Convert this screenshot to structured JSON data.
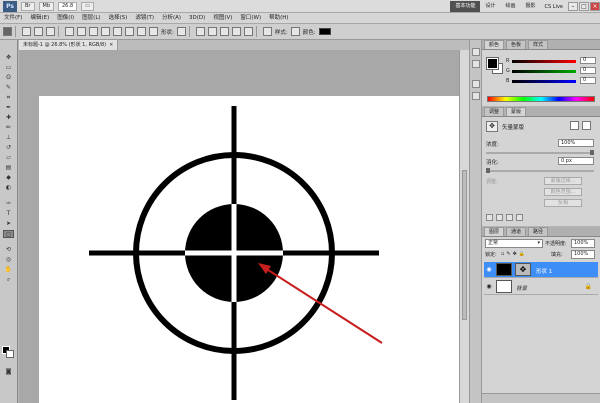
{
  "appbar": {
    "logo": "Ps",
    "zoom": "26.8",
    "workspaces": [
      {
        "label": "基本功能",
        "active": true
      },
      {
        "label": "设计",
        "active": false
      },
      {
        "label": "绘画",
        "active": false
      },
      {
        "label": "摄影",
        "active": false
      }
    ],
    "cs_live": "CS Live"
  },
  "menu": [
    "文件(F)",
    "编辑(E)",
    "图像(I)",
    "图层(L)",
    "选择(S)",
    "滤镜(T)",
    "分析(A)",
    "3D(D)",
    "视图(V)",
    "窗口(W)",
    "帮助(H)"
  ],
  "options": {
    "shape_label": "形状:",
    "style_label": "样式:",
    "color_label": "颜色:",
    "color_value": "#000000"
  },
  "document": {
    "tab_title": "未标题-1 @ 26.8% (形状 1, RGB/8)",
    "close": "×"
  },
  "color_panel": {
    "tabs": [
      "颜色",
      "色板",
      "样式"
    ],
    "channels": [
      {
        "name": "R",
        "value": "0",
        "color": "#ff0000"
      },
      {
        "name": "G",
        "value": "0",
        "color": "#00aa00"
      },
      {
        "name": "B",
        "value": "0",
        "color": "#0000ff"
      }
    ]
  },
  "masks_panel": {
    "tabs": [
      "调整",
      "蒙版"
    ],
    "title": "矢量蒙版",
    "density_label": "浓度:",
    "density_value": "100%",
    "feather_label": "羽化:",
    "feather_value": "0 px",
    "refine_label": "调整:",
    "buttons": [
      "蒙版边缘...",
      "颜色范围...",
      "反相"
    ]
  },
  "layers_panel": {
    "tabs": [
      "图层",
      "通道",
      "路径"
    ],
    "blend_mode": "正常",
    "opacity_label": "不透明度:",
    "opacity_value": "100%",
    "lock_label": "锁定:",
    "fill_label": "填充:",
    "fill_value": "100%",
    "layers": [
      {
        "name": "形状 1",
        "selected": true
      },
      {
        "name": "背景",
        "selected": false
      }
    ]
  }
}
